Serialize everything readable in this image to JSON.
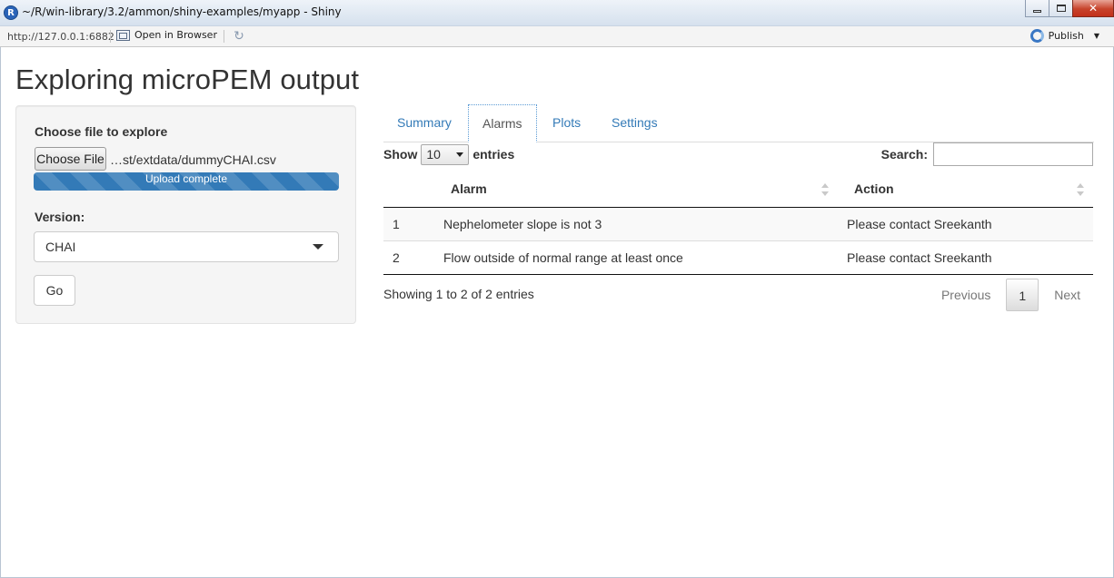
{
  "window": {
    "title": "~/R/win-library/3.2/ammon/shiny-examples/myapp - Shiny",
    "r_logo": "R"
  },
  "toolbar": {
    "url": "http://127.0.0.1:6882",
    "open_in_browser": "Open in Browser",
    "publish": "Publish"
  },
  "app": {
    "title": "Exploring microPEM output"
  },
  "sidebar": {
    "file_label": "Choose file to explore",
    "file_button": "Choose File",
    "file_name": "…st/extdata/dummyCHAI.csv",
    "upload_status": "Upload complete",
    "upload_progress": 1.0,
    "version_label": "Version:",
    "version_value": "CHAI",
    "go_button": "Go"
  },
  "tabs": [
    {
      "label": "Summary",
      "active": false
    },
    {
      "label": "Alarms",
      "active": true
    },
    {
      "label": "Plots",
      "active": false
    },
    {
      "label": "Settings",
      "active": false
    }
  ],
  "datatable": {
    "show_label": "Show",
    "length_value": "10",
    "entries_label": "entries",
    "search_label": "Search:",
    "search_value": "",
    "columns": [
      "",
      "Alarm",
      "Action"
    ],
    "rows": [
      [
        "1",
        "Nephelometer slope is not 3",
        "Please contact Sreekanth"
      ],
      [
        "2",
        "Flow outside of normal range at least once",
        "Please contact Sreekanth"
      ]
    ],
    "info": "Showing 1 to 2 of 2 entries",
    "pagination": {
      "previous": "Previous",
      "current_page": "1",
      "next": "Next"
    }
  },
  "colors": {
    "link": "#337ab7",
    "progress": "#337ab7",
    "close_button": "#c7432b"
  }
}
